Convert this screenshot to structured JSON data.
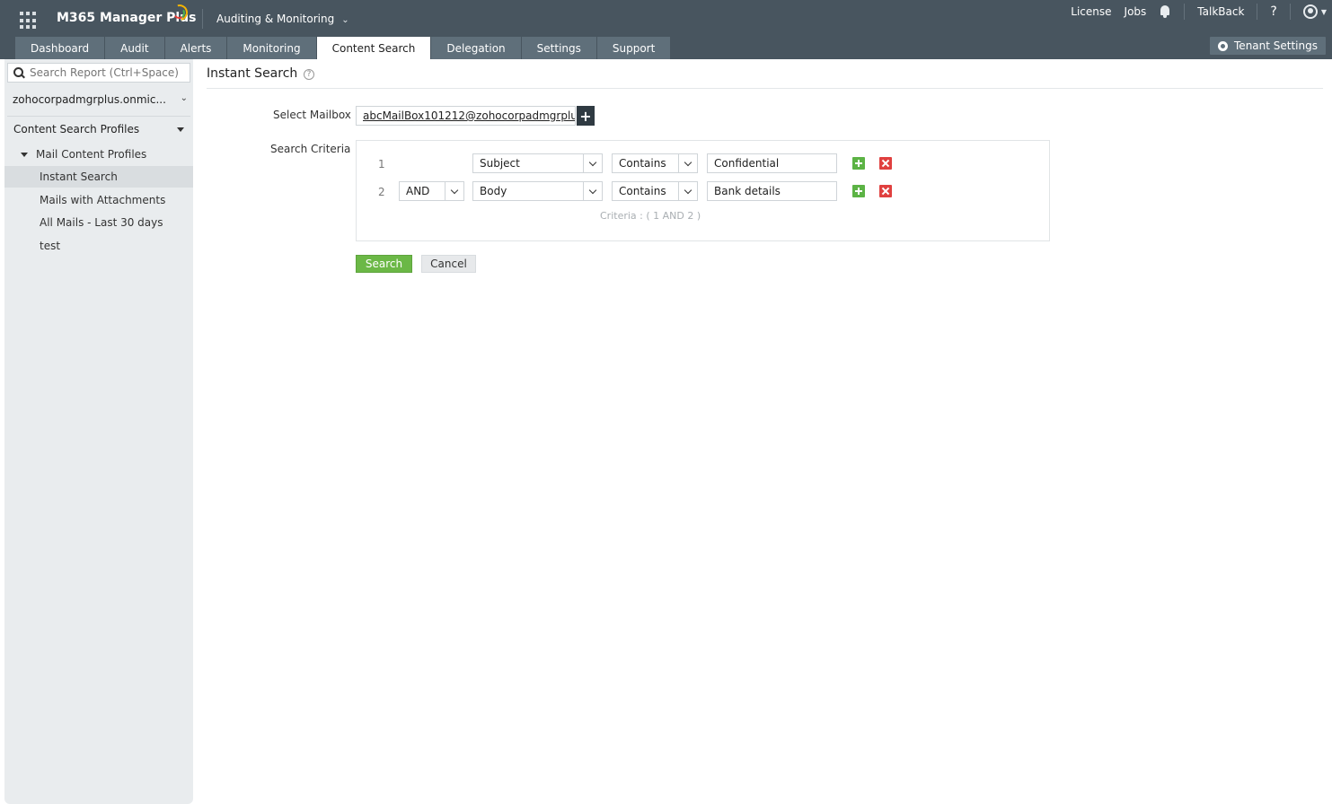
{
  "header": {
    "app_name": "M365 Manager Plus",
    "module": "Auditing & Monitoring",
    "links": {
      "license": "License",
      "jobs": "Jobs",
      "talkback": "TalkBack",
      "help": "?"
    },
    "tenant_settings": "Tenant Settings"
  },
  "nav": {
    "tabs": [
      {
        "label": "Dashboard",
        "active": false
      },
      {
        "label": "Audit",
        "active": false
      },
      {
        "label": "Alerts",
        "active": false
      },
      {
        "label": "Monitoring",
        "active": false
      },
      {
        "label": "Content Search",
        "active": true
      },
      {
        "label": "Delegation",
        "active": false
      },
      {
        "label": "Settings",
        "active": false
      },
      {
        "label": "Support",
        "active": false
      }
    ]
  },
  "sidebar": {
    "search_placeholder": "Search Report (Ctrl+Space)",
    "tenant": "zohocorpadmgrplus.onmic...",
    "section": "Content Search Profiles",
    "group": "Mail Content Profiles",
    "items": [
      {
        "label": "Instant Search",
        "active": true
      },
      {
        "label": "Mails with Attachments",
        "active": false
      },
      {
        "label": "All Mails - Last 30 days",
        "active": false
      },
      {
        "label": "test",
        "active": false
      }
    ]
  },
  "main": {
    "title": "Instant Search",
    "help_icon": "?",
    "select_mailbox_label": "Select Mailbox",
    "mailbox_value": "abcMailBox101212@zohocorpadmgrplus....",
    "search_criteria_label": "Search Criteria",
    "criteria_rows": [
      {
        "num": "1",
        "operator": "",
        "field": "Subject",
        "condition": "Contains",
        "value": "Confidential"
      },
      {
        "num": "2",
        "operator": "AND",
        "field": "Body",
        "condition": "Contains",
        "value": "Bank details"
      }
    ],
    "criteria_summary": "Criteria : ( 1 AND 2 )",
    "search_button": "Search",
    "cancel_button": "Cancel"
  },
  "colors": {
    "header_bg": "#48555f",
    "tab_bg": "#5f6f7a",
    "search_green": "#6bb846",
    "add_green": "#5cb345",
    "delete_red": "#e0403f"
  },
  "icons": [
    "app-grid-icon",
    "brand-logo-icon",
    "chevron-down-icon",
    "bell-icon",
    "user-icon",
    "gear-icon",
    "search-icon",
    "help-icon",
    "plus-icon",
    "add-icon",
    "delete-icon"
  ]
}
